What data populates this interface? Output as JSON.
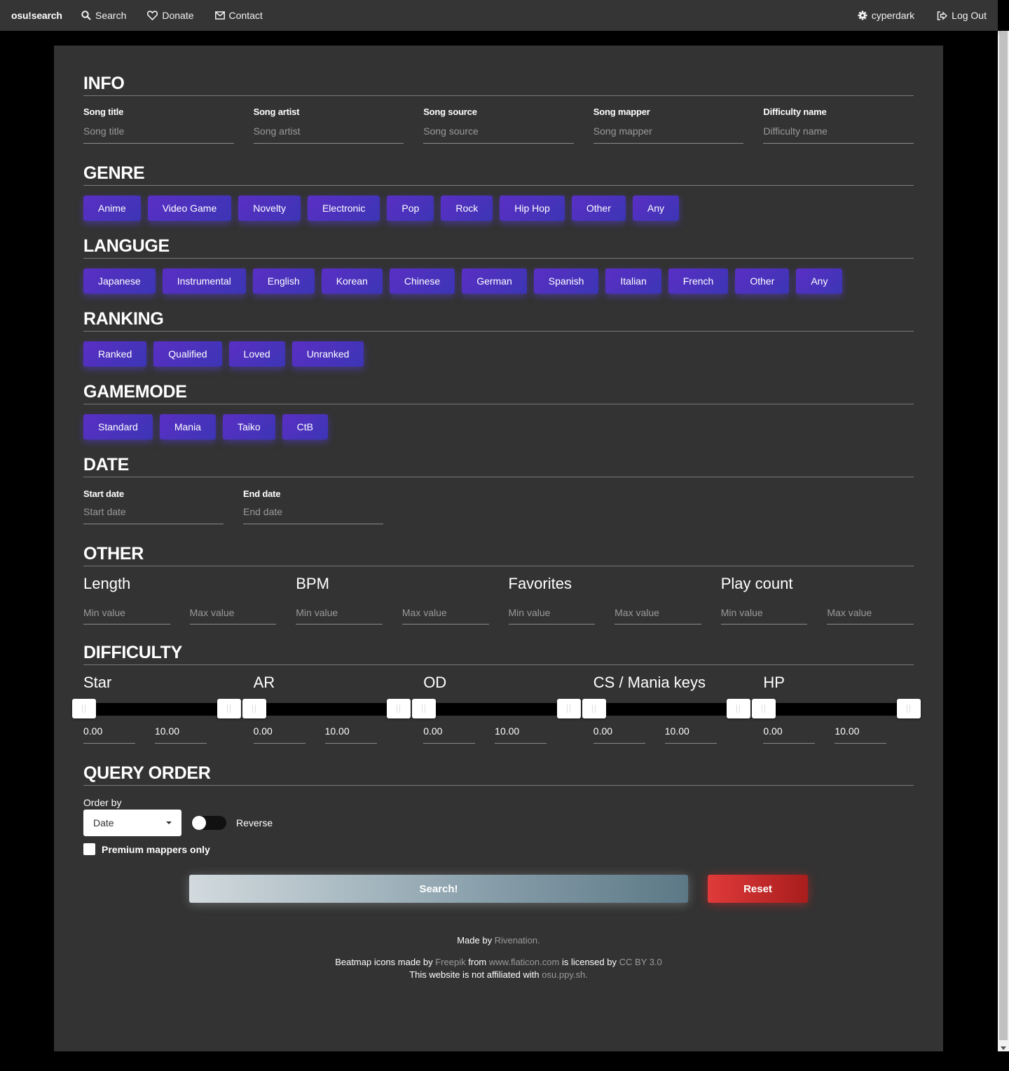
{
  "nav": {
    "brand": "osu!search",
    "search": "Search",
    "donate": "Donate",
    "contact": "Contact",
    "user": "cyperdark",
    "logout": "Log Out"
  },
  "info": {
    "title": "INFO",
    "fields": [
      {
        "label": "Song title",
        "placeholder": "Song title"
      },
      {
        "label": "Song artist",
        "placeholder": "Song artist"
      },
      {
        "label": "Song source",
        "placeholder": "Song source"
      },
      {
        "label": "Song mapper",
        "placeholder": "Song mapper"
      },
      {
        "label": "Difficulty name",
        "placeholder": "Difficulty name"
      }
    ]
  },
  "genre": {
    "title": "GENRE",
    "items": [
      "Anime",
      "Video Game",
      "Novelty",
      "Electronic",
      "Pop",
      "Rock",
      "Hip Hop",
      "Other",
      "Any"
    ]
  },
  "language": {
    "title": "LANGUGE",
    "items": [
      "Japanese",
      "Instrumental",
      "English",
      "Korean",
      "Chinese",
      "German",
      "Spanish",
      "Italian",
      "French",
      "Other",
      "Any"
    ]
  },
  "ranking": {
    "title": "RANKING",
    "items": [
      "Ranked",
      "Qualified",
      "Loved",
      "Unranked"
    ]
  },
  "gamemode": {
    "title": "GAMEMODE",
    "items": [
      "Standard",
      "Mania",
      "Taiko",
      "CtB"
    ]
  },
  "date": {
    "title": "DATE",
    "start_label": "Start date",
    "start_placeholder": "Start date",
    "end_label": "End date",
    "end_placeholder": "End date"
  },
  "other": {
    "title": "OTHER",
    "min_placeholder": "Min value",
    "max_placeholder": "Max value",
    "items": [
      "Length",
      "BPM",
      "Favorites",
      "Play count"
    ]
  },
  "difficulty": {
    "title": "DIFFICULTY",
    "items": [
      {
        "name": "Star",
        "min": "0.00",
        "max": "10.00"
      },
      {
        "name": "AR",
        "min": "0.00",
        "max": "10.00"
      },
      {
        "name": "OD",
        "min": "0.00",
        "max": "10.00"
      },
      {
        "name": "CS / Mania keys",
        "min": "0.00",
        "max": "10.00"
      },
      {
        "name": "HP",
        "min": "0.00",
        "max": "10.00"
      }
    ]
  },
  "query": {
    "title": "QUERY ORDER",
    "order_label": "Order by",
    "order_value": "Date",
    "reverse_label": "Reverse",
    "premium_label": "Premium mappers only"
  },
  "actions": {
    "search": "Search!",
    "reset": "Reset"
  },
  "footer": {
    "made_by": "Made by",
    "author": "Rivenation.",
    "icons_prefix": "Beatmap icons made by",
    "freepik": "Freepik",
    "from": "from",
    "flaticon": "www.flaticon.com",
    "licensed": "is licensed by",
    "license": "CC BY 3.0",
    "affiliation": "This website is not affiliated with",
    "osu_site": "osu.ppy.sh."
  }
}
